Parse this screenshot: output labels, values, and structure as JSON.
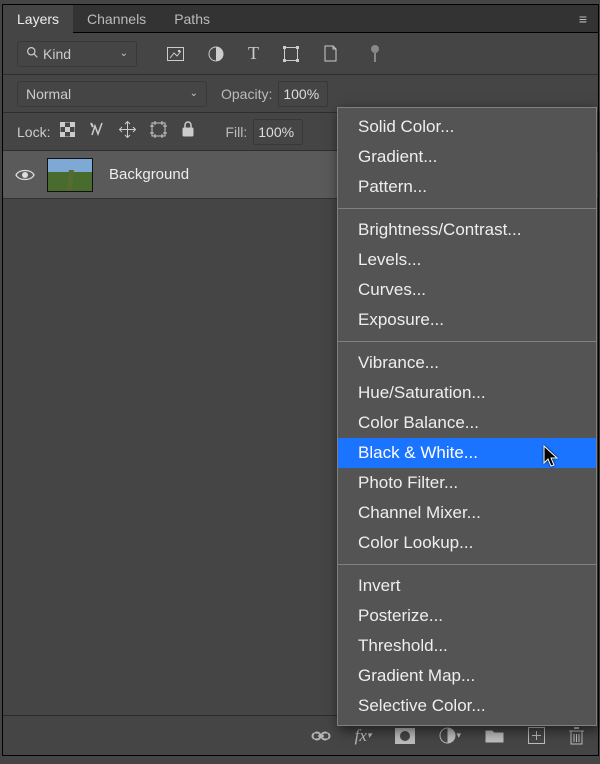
{
  "tabs": {
    "layers": "Layers",
    "channels": "Channels",
    "paths": "Paths"
  },
  "filter": {
    "kind": "Kind"
  },
  "blend": {
    "mode": "Normal",
    "opacity_label": "Opacity:",
    "opacity_value": "100%"
  },
  "lock": {
    "label": "Lock:",
    "fill_label": "Fill:",
    "fill_value": "100%"
  },
  "layer": {
    "name": "Background"
  },
  "menu": {
    "g1": [
      "Solid Color...",
      "Gradient...",
      "Pattern..."
    ],
    "g2": [
      "Brightness/Contrast...",
      "Levels...",
      "Curves...",
      "Exposure..."
    ],
    "g3": [
      "Vibrance...",
      "Hue/Saturation...",
      "Color Balance...",
      "Black & White...",
      "Photo Filter...",
      "Channel Mixer...",
      "Color Lookup..."
    ],
    "g4": [
      "Invert",
      "Posterize...",
      "Threshold...",
      "Gradient Map...",
      "Selective Color..."
    ]
  },
  "highlighted": "Black & White..."
}
